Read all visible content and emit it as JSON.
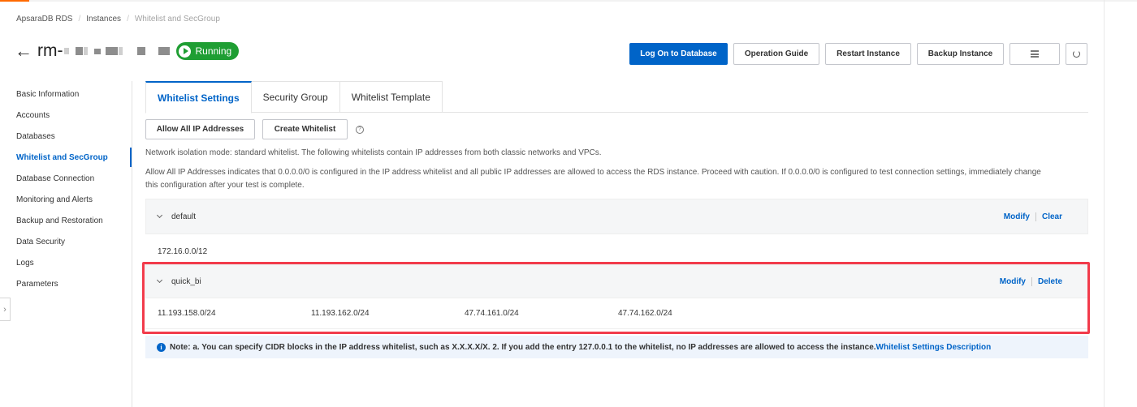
{
  "breadcrumb": [
    "ApsaraDB RDS",
    "Instances",
    "Whitelist and SecGroup"
  ],
  "instance": {
    "id_prefix": "rm-",
    "status": "Running"
  },
  "colors": {
    "accent": "#0064c8",
    "running": "#1f9e33",
    "highlight": "#f23b4b",
    "brand": "#ff6a00"
  },
  "header_actions": {
    "log_on": "Log On to Database",
    "guide": "Operation Guide",
    "restart": "Restart Instance",
    "backup": "Backup Instance",
    "icons": [
      "list-icon",
      "refresh-icon"
    ]
  },
  "sidebar": {
    "items": [
      {
        "label": "Basic Information"
      },
      {
        "label": "Accounts"
      },
      {
        "label": "Databases"
      },
      {
        "label": "Whitelist and SecGroup",
        "active": true
      },
      {
        "label": "Database Connection"
      },
      {
        "label": "Monitoring and Alerts"
      },
      {
        "label": "Backup and Restoration"
      },
      {
        "label": "Data Security"
      },
      {
        "label": "Logs"
      },
      {
        "label": "Parameters"
      }
    ]
  },
  "tabs": [
    {
      "label": "Whitelist Settings",
      "active": true
    },
    {
      "label": "Security Group"
    },
    {
      "label": "Whitelist Template"
    }
  ],
  "whitelist_actions": {
    "allow_all": "Allow All IP Addresses",
    "create": "Create Whitelist",
    "help": "?"
  },
  "descriptions": {
    "mode": "Network isolation mode: standard whitelist. The following whitelists contain IP addresses from both classic networks and VPCs.",
    "warning_line1": "Allow All IP Addresses indicates that 0.0.0.0/0 is configured in the IP address whitelist and all public IP addresses are allowed to access the RDS instance. Proceed with caution. If 0.0.0.0/0 is configured to test connection settings, immediately change",
    "warning_line2": "this configuration after your test is complete."
  },
  "whitelists": [
    {
      "name": "default",
      "actions": [
        "Modify",
        "Clear"
      ],
      "ips": [
        "172.16.0.0/12"
      ]
    },
    {
      "name": "quick_bi",
      "actions": [
        "Modify",
        "Delete"
      ],
      "ips": [
        "11.193.158.0/24",
        "11.193.162.0/24",
        "47.74.161.0/24",
        "47.74.162.0/24"
      ]
    }
  ],
  "note": {
    "icon": "i",
    "text": "Note: a. You can specify CIDR blocks in the IP address whitelist, such as X.X.X.X/X. 2. If you add the entry 127.0.0.1 to the whitelist, no IP addresses are allowed to access the instance.",
    "link": "Whitelist Settings Description"
  }
}
